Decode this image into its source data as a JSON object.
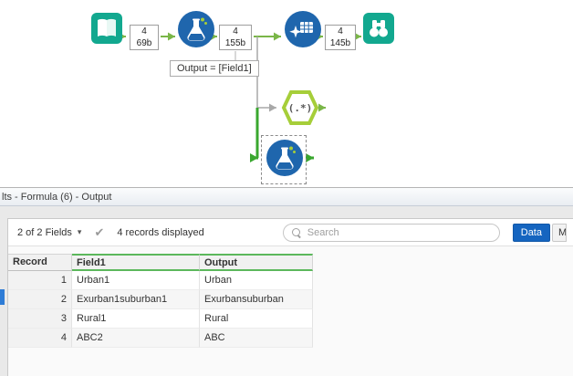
{
  "canvas": {
    "annotation": "Output = [Field1]",
    "regex_label": "(.*)",
    "badges": [
      {
        "count": "4",
        "size": "69b"
      },
      {
        "count": "4",
        "size": "155b"
      },
      {
        "count": "4",
        "size": "145b"
      }
    ]
  },
  "results": {
    "title": "lts - Formula (6) - Output",
    "toolbar": {
      "fields_dropdown": "2 of 2 Fields",
      "records_text": "4 records displayed",
      "search_placeholder": "Search",
      "data_button": "Data",
      "metadata_button": "M"
    },
    "table": {
      "columns": [
        "Record",
        "Field1",
        "Output"
      ],
      "rows": [
        {
          "record": "1",
          "field1": "Urban1",
          "output": "Urban"
        },
        {
          "record": "2",
          "field1": "Exurban1suburban1",
          "output": "Exurbansuburban"
        },
        {
          "record": "3",
          "field1": "Rural1",
          "output": "Rural"
        },
        {
          "record": "4",
          "field1": "ABC2",
          "output": "ABC"
        }
      ]
    }
  },
  "icons": {
    "dropdown_caret": "▾",
    "check_mark": "✔"
  },
  "colors": {
    "tool_teal": "#12a88f",
    "tool_blue": "#1f66ad",
    "wire_green": "#7ab648",
    "selected_wire_green": "#3aa72f",
    "regex_green": "#a6ce39",
    "data_button_blue": "#1565c0",
    "header_accent_green": "#5cb85c",
    "selection_blue": "#2e7cd6"
  }
}
